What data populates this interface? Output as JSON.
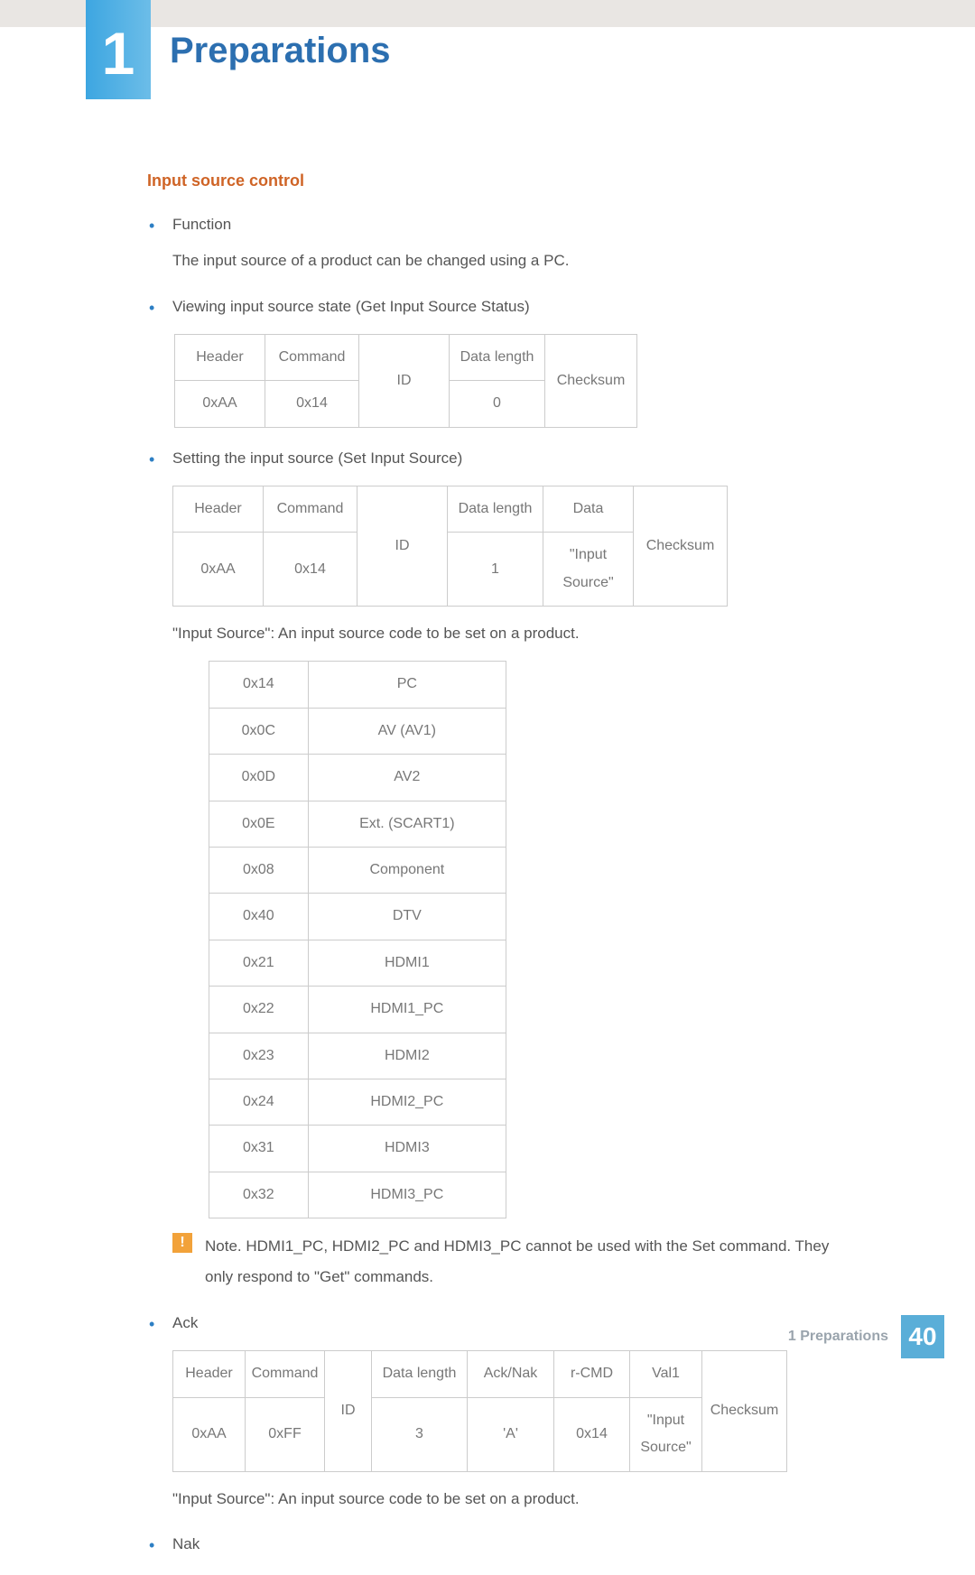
{
  "chapter_number": "1",
  "chapter_title": "Preparations",
  "section_title": "Input source control",
  "items": {
    "function": {
      "label": "Function",
      "desc": "The input source of a product can be changed using a PC."
    },
    "view_state": {
      "label": "Viewing input source state (Get Input Source Status)"
    },
    "set_source": {
      "label": "Setting the input source (Set Input Source)"
    },
    "source_desc": "\"Input Source\": An input source code to be set on a product.",
    "ack": {
      "label": "Ack"
    },
    "nak": {
      "label": "Nak"
    }
  },
  "table1": {
    "headers": [
      "Header",
      "Command",
      "ID",
      "Data length",
      "Checksum"
    ],
    "row": [
      "0xAA",
      "0x14",
      "",
      "0",
      ""
    ]
  },
  "table2": {
    "headers": [
      "Header",
      "Command",
      "ID",
      "Data length",
      "Data",
      "Checksum"
    ],
    "row": [
      "0xAA",
      "0x14",
      "",
      "1",
      "\"Input Source\"",
      ""
    ]
  },
  "codes": [
    [
      "0x14",
      "PC"
    ],
    [
      "0x0C",
      "AV (AV1)"
    ],
    [
      "0x0D",
      "AV2"
    ],
    [
      "0x0E",
      "Ext. (SCART1)"
    ],
    [
      "0x08",
      "Component"
    ],
    [
      "0x40",
      "DTV"
    ],
    [
      "0x21",
      "HDMI1"
    ],
    [
      "0x22",
      "HDMI1_PC"
    ],
    [
      "0x23",
      "HDMI2"
    ],
    [
      "0x24",
      "HDMI2_PC"
    ],
    [
      "0x31",
      "HDMI3"
    ],
    [
      "0x32",
      "HDMI3_PC"
    ]
  ],
  "note": {
    "icon": "!",
    "text": "Note. HDMI1_PC, HDMI2_PC and HDMI3_PC cannot be used with the Set command. They only respond to \"Get\" commands."
  },
  "ack_table": {
    "headers": [
      "Header",
      "Command",
      "ID",
      "Data length",
      "Ack/Nak",
      "r-CMD",
      "Val1",
      "Checksum"
    ],
    "row": [
      "0xAA",
      "0xFF",
      "",
      "3",
      "'A'",
      "0x14",
      "\"Input Source\"",
      ""
    ]
  },
  "ack_desc": "\"Input Source\": An input source code to be set on a product.",
  "footer": {
    "text": "1 Preparations",
    "page": "40"
  }
}
